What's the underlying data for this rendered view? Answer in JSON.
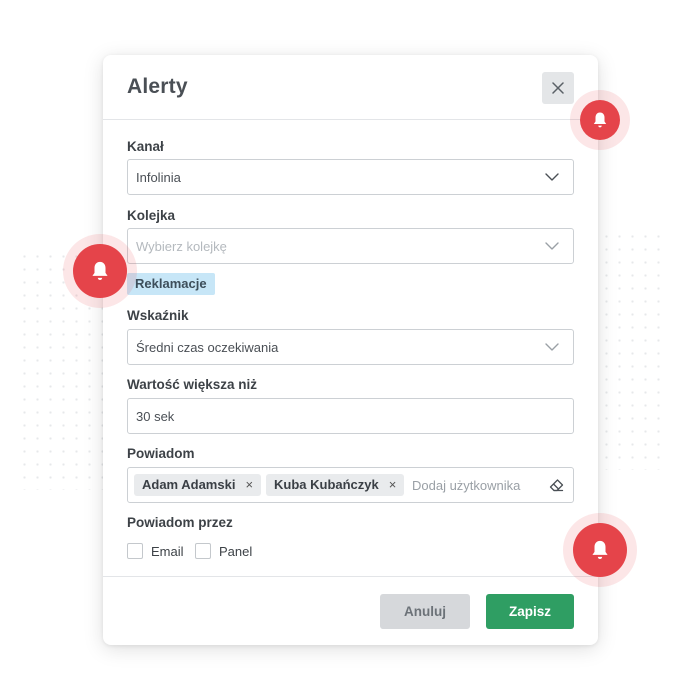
{
  "colors": {
    "accent_green": "#2f9e63",
    "bell_red": "#e5444a",
    "tag_blue": "#c7e6f7"
  },
  "modal": {
    "title": "Alerty",
    "close_icon": "close-icon"
  },
  "form": {
    "kanal": {
      "label": "Kanał",
      "value": "Infolinia"
    },
    "kolejka": {
      "label": "Kolejka",
      "placeholder": "Wybierz kolejkę",
      "selected_tag": "Reklamacje"
    },
    "wskaznik": {
      "label": "Wskaźnik",
      "value": "Średni czas oczekiwania"
    },
    "wartosc": {
      "label": "Wartość większa niż",
      "value": "30 sek"
    },
    "powiadom": {
      "label": "Powiadom",
      "users": [
        {
          "name": "Adam Adamski",
          "remove": "×"
        },
        {
          "name": "Kuba Kubańczyk",
          "remove": "×"
        }
      ],
      "placeholder": "Dodaj użytkownika"
    },
    "powiadom_przez": {
      "label": "Powiadom przez",
      "options": [
        {
          "label": "Email"
        },
        {
          "label": "Panel"
        }
      ]
    }
  },
  "buttons": {
    "cancel": "Anuluj",
    "save": "Zapisz"
  },
  "decorations": {
    "icons": [
      "bell-icon",
      "bell-icon",
      "bell-icon"
    ]
  }
}
